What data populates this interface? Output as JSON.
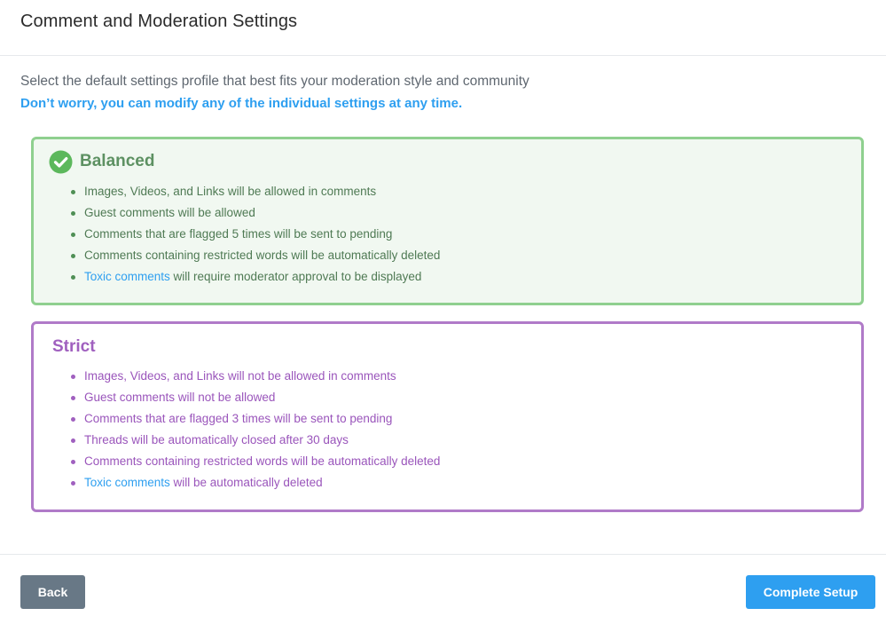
{
  "header": {
    "title": "Comment and Moderation Settings"
  },
  "intro": {
    "subtitle": "Select the default settings profile that best fits your moderation style and community",
    "note": "Don’t worry, you can modify any of the individual settings at any time."
  },
  "profiles": [
    {
      "name": "Balanced",
      "selected": true,
      "accent_color": "#8fd08f",
      "icon": "check-circle-icon",
      "items": [
        {
          "text": "Images, Videos, and Links will be allowed in comments"
        },
        {
          "text": "Guest comments will be allowed"
        },
        {
          "text": "Comments that are flagged 5 times will be sent to pending"
        },
        {
          "text": "Comments containing restricted words will be automatically deleted"
        },
        {
          "link": "Toxic comments",
          "text": " will require moderator approval to be displayed"
        }
      ]
    },
    {
      "name": "Strict",
      "selected": false,
      "accent_color": "#b07ac8",
      "items": [
        {
          "text": "Images, Videos, and Links will not be allowed in comments"
        },
        {
          "text": "Guest comments will not be allowed"
        },
        {
          "text": "Comments that are flagged 3 times will be sent to pending"
        },
        {
          "text": "Threads will be automatically closed after 30 days"
        },
        {
          "text": "Comments containing restricted words will be automatically deleted"
        },
        {
          "link": "Toxic comments",
          "text": " will be automatically deleted"
        }
      ]
    }
  ],
  "footer": {
    "back_label": "Back",
    "complete_label": "Complete Setup"
  },
  "colors": {
    "primary": "#2e9ff0",
    "back_button": "#687886",
    "balanced_text": "#4f7a54",
    "strict_text": "#a060bf"
  }
}
